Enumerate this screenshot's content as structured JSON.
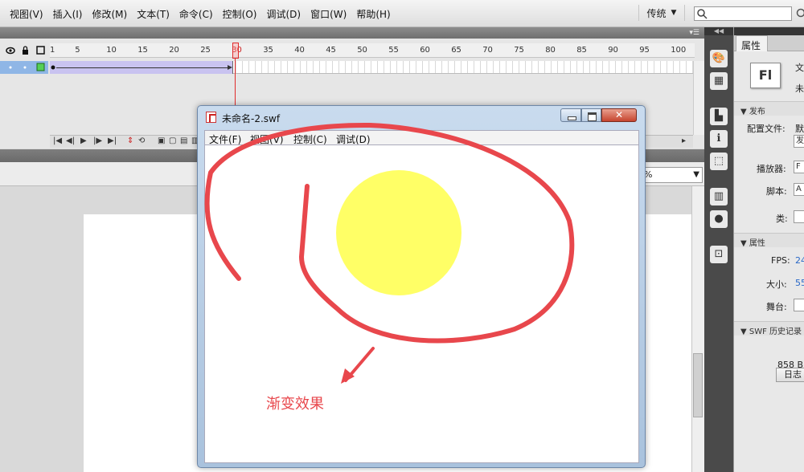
{
  "menubar": {
    "items": [
      "视图(V)",
      "插入(I)",
      "修改(M)",
      "文本(T)",
      "命令(C)",
      "控制(O)",
      "调试(D)",
      "窗口(W)",
      "帮助(H)"
    ],
    "workspace_label": "传统",
    "search_placeholder": ""
  },
  "timeline": {
    "frame_labels": [
      "1",
      "5",
      "10",
      "15",
      "20",
      "25",
      "30",
      "35",
      "40",
      "45",
      "50",
      "55",
      "60",
      "65",
      "70",
      "75",
      "80",
      "85",
      "90",
      "95",
      "100"
    ],
    "current_frame": "30",
    "tween_color": "#c9c3f0"
  },
  "stage": {
    "zoom_value": "%"
  },
  "swf_window": {
    "title": "未命名-2.swf",
    "close_label": "✕",
    "menu": [
      "文件(F)",
      "视图(V)",
      "控制(C)",
      "调试(D)"
    ],
    "circle_color": "#ffff66"
  },
  "annotation": {
    "text": "渐变效果",
    "color": "#e8474c"
  },
  "properties": {
    "tab_label": "属性",
    "doc_icon_label": "Fl",
    "doc_label": "文",
    "doc_name": "未",
    "publish_header": "发布",
    "profile_label": "配置文件:",
    "profile_value": "默",
    "publish_button": "发",
    "player_label": "播放器:",
    "player_value": "F",
    "script_label": "脚本:",
    "script_value": "A",
    "class_label": "类:",
    "attributes_header": "属性",
    "fps_label": "FPS:",
    "fps_value": "24",
    "size_label": "大小:",
    "size_value": "55",
    "stage_label": "舞台:",
    "history_header": "SWF 历史记录",
    "log_button": "日志",
    "file_size": "858 B"
  }
}
